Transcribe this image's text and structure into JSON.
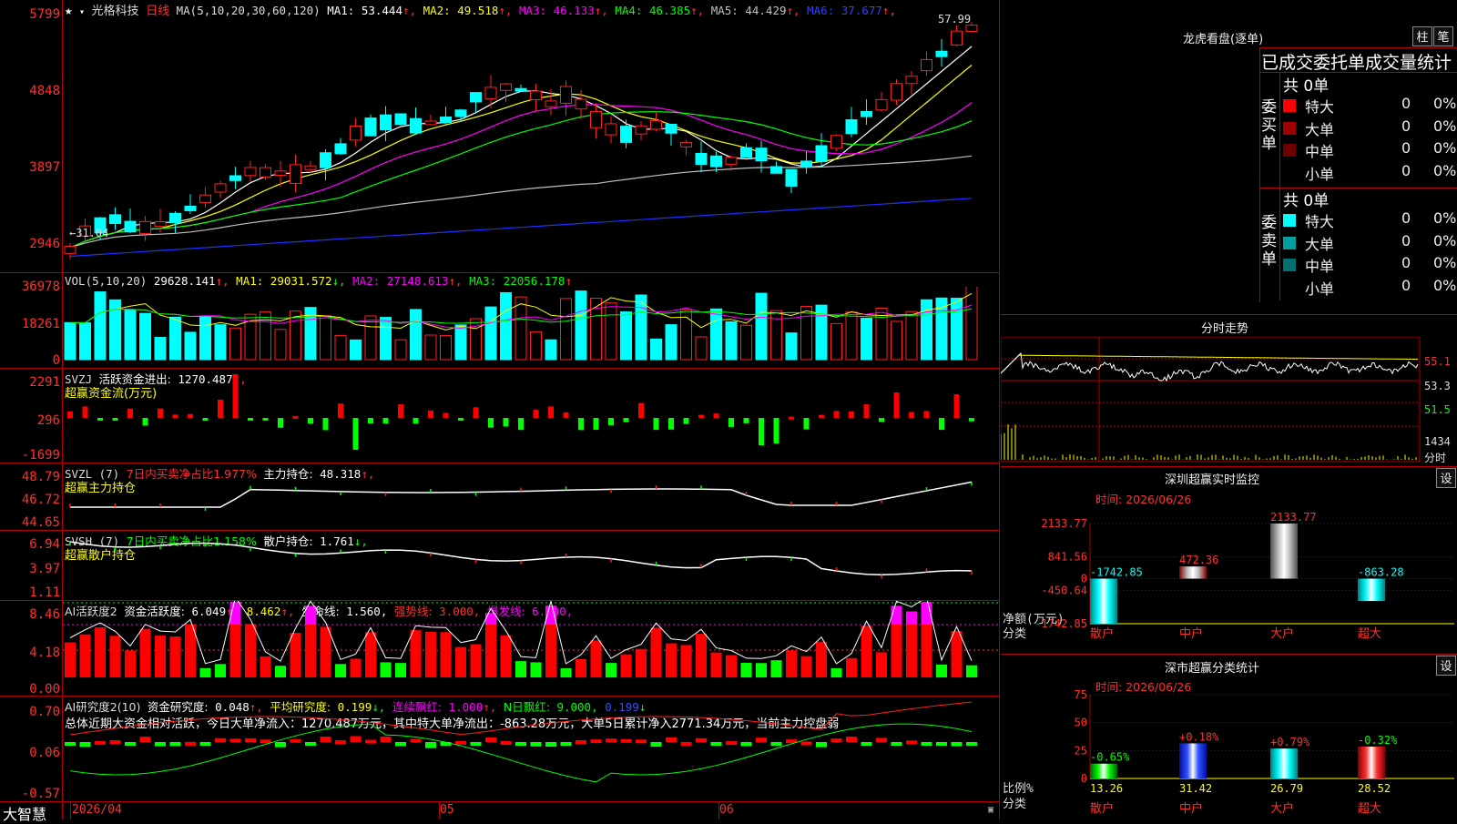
{
  "main": {
    "stock_name": "光格科技",
    "period": "日线",
    "ma_params": "MA(5,10,20,30,60,120)",
    "ma_values": [
      {
        "label": "MA1:",
        "value": "53.444",
        "color": "#ffffff"
      },
      {
        "label": "MA2:",
        "value": "49.518",
        "color": "#ffff00"
      },
      {
        "label": "MA3:",
        "value": "46.133",
        "color": "#ff00ff"
      },
      {
        "label": "MA4:",
        "value": "46.385",
        "color": "#00ff00"
      },
      {
        "label": "MA5:",
        "value": "44.429",
        "color": "#c0c0c0"
      },
      {
        "label": "MA6:",
        "value": "37.677",
        "color": "#3040ff"
      }
    ],
    "y_labels": [
      "5799",
      "4848",
      "3897",
      "2946"
    ],
    "high_label": "57.99",
    "low_label": "31.04"
  },
  "vol": {
    "title": "VOL(5,10,20)",
    "value": "29628.141",
    "ma1": "MA1: 29031.572",
    "ma2": "MA2: 27148.613",
    "ma3": "MA3: 22056.178",
    "y_labels": [
      "36978",
      "18261",
      "0"
    ]
  },
  "svzj": {
    "title": "SVZJ",
    "label": "活跃资金进出:",
    "value": "1270.487",
    "sub": "超赢资金流(万元)",
    "y_labels": [
      "2291",
      "296",
      "-1699"
    ]
  },
  "svzl": {
    "title": "SVZL (7)",
    "desc": "7日内买卖净占比1.977%",
    "label": "主力持仓:",
    "value": "48.318",
    "sub": "超赢主力持仓",
    "y_labels": [
      "48.79",
      "46.72",
      "44.65"
    ]
  },
  "svsh": {
    "title": "SVSH (7)",
    "desc": "7日内买卖净占比1.158%",
    "label": "散户持仓:",
    "value": "1.761",
    "sub": "超赢散户持仓",
    "y_labels": [
      "6.94",
      "3.97",
      "1.11"
    ]
  },
  "ai_active": {
    "title": "AI活跃度2",
    "label1": "资金活跃度:",
    "value1": "6.049",
    "value2": "8.462",
    "label3": "生命线:",
    "value3": "1.560",
    "label4": "强势线:",
    "value4": "3.000",
    "label5": "爆发线:",
    "value5": "6.000",
    "y_labels": [
      "8.46",
      "4.18",
      "0.00"
    ]
  },
  "ai_research": {
    "title": "AI研究度2(10)",
    "label1": "资金研究度:",
    "value1": "0.048",
    "label2": "平均研究度:",
    "value2": "0.199",
    "label3": "连续飘红:",
    "value3": "1.000",
    "label4": "N日飘红:",
    "value4": "9.000",
    "value5": "0.199",
    "summary": "总体近期大资金相对活跃，今日大单净流入：1270.487万元，其中特大单净流出：-863.28万元，大单5日累计净入2771.34万元，当前主力控盘弱",
    "y_labels": [
      "0.70",
      "0.06",
      "-0.57"
    ]
  },
  "bottom": {
    "brand": "大智慧",
    "dates": [
      "2026/04",
      "05",
      "06"
    ]
  },
  "longhu": {
    "title": "龙虎看盘(逐单)",
    "btn1": "柱",
    "btn2": "笔",
    "stat_title": "已成交委托单成交量统计",
    "buy_label": "委买单",
    "sell_label": "委卖单",
    "buy_total": "共 0单",
    "sell_total": "共 0单",
    "buy_rows": [
      {
        "name": "特大",
        "count": "0",
        "pct": "0%",
        "color": "#ff0000"
      },
      {
        "name": "大单",
        "count": "0",
        "pct": "0%",
        "color": "#a00000"
      },
      {
        "name": "中单",
        "count": "0",
        "pct": "0%",
        "color": "#700000"
      },
      {
        "name": "小单",
        "count": "0",
        "pct": "0%",
        "color": "#000000"
      }
    ],
    "sell_rows": [
      {
        "name": "特大",
        "count": "0",
        "pct": "0%",
        "color": "#00ffff"
      },
      {
        "name": "大单",
        "count": "0",
        "pct": "0%",
        "color": "#00a0a0"
      },
      {
        "name": "中单",
        "count": "0",
        "pct": "0%",
        "color": "#007070"
      },
      {
        "name": "小单",
        "count": "0",
        "pct": "0%",
        "color": "#000000"
      }
    ]
  },
  "intraday": {
    "title": "分时走势",
    "y_labels": [
      "55.1",
      "53.3",
      "51.5"
    ],
    "vol_label": "1434",
    "bottom_label": "分时"
  },
  "sz_monitor": {
    "title": "深圳超赢实时监控",
    "btn": "设",
    "time": "时间: 2026/06/26",
    "y_labels": [
      "2133.77",
      "841.56",
      "0",
      "-450.64",
      "-1742.85"
    ],
    "axis_label1": "净额(万元)",
    "axis_label2": "分类",
    "chart_data": {
      "type": "bar",
      "categories": [
        "散户",
        "中户",
        "大户",
        "超大"
      ],
      "values": [
        -1742.85,
        472.36,
        2133.77,
        -863.28
      ],
      "value_labels": [
        "-1742.85",
        "472.36",
        "2133.77",
        "-863.28"
      ],
      "ylim": [
        -1742.85,
        2133.77
      ]
    }
  },
  "sz_class": {
    "title": "深市超赢分类统计",
    "btn": "设",
    "time": "时间: 2026/06/26",
    "y_labels": [
      "75",
      "50",
      "25",
      "0"
    ],
    "axis_label1": "比例%",
    "axis_label2": "分类",
    "chart_data": {
      "type": "bar",
      "categories": [
        "散户",
        "中户",
        "大户",
        "超大"
      ],
      "values": [
        13.26,
        31.42,
        26.79,
        28.52
      ],
      "changes": [
        "-0.65%",
        "+0.18%",
        "+0.79%",
        "-0.32%"
      ],
      "ylim": [
        0,
        75
      ]
    }
  }
}
